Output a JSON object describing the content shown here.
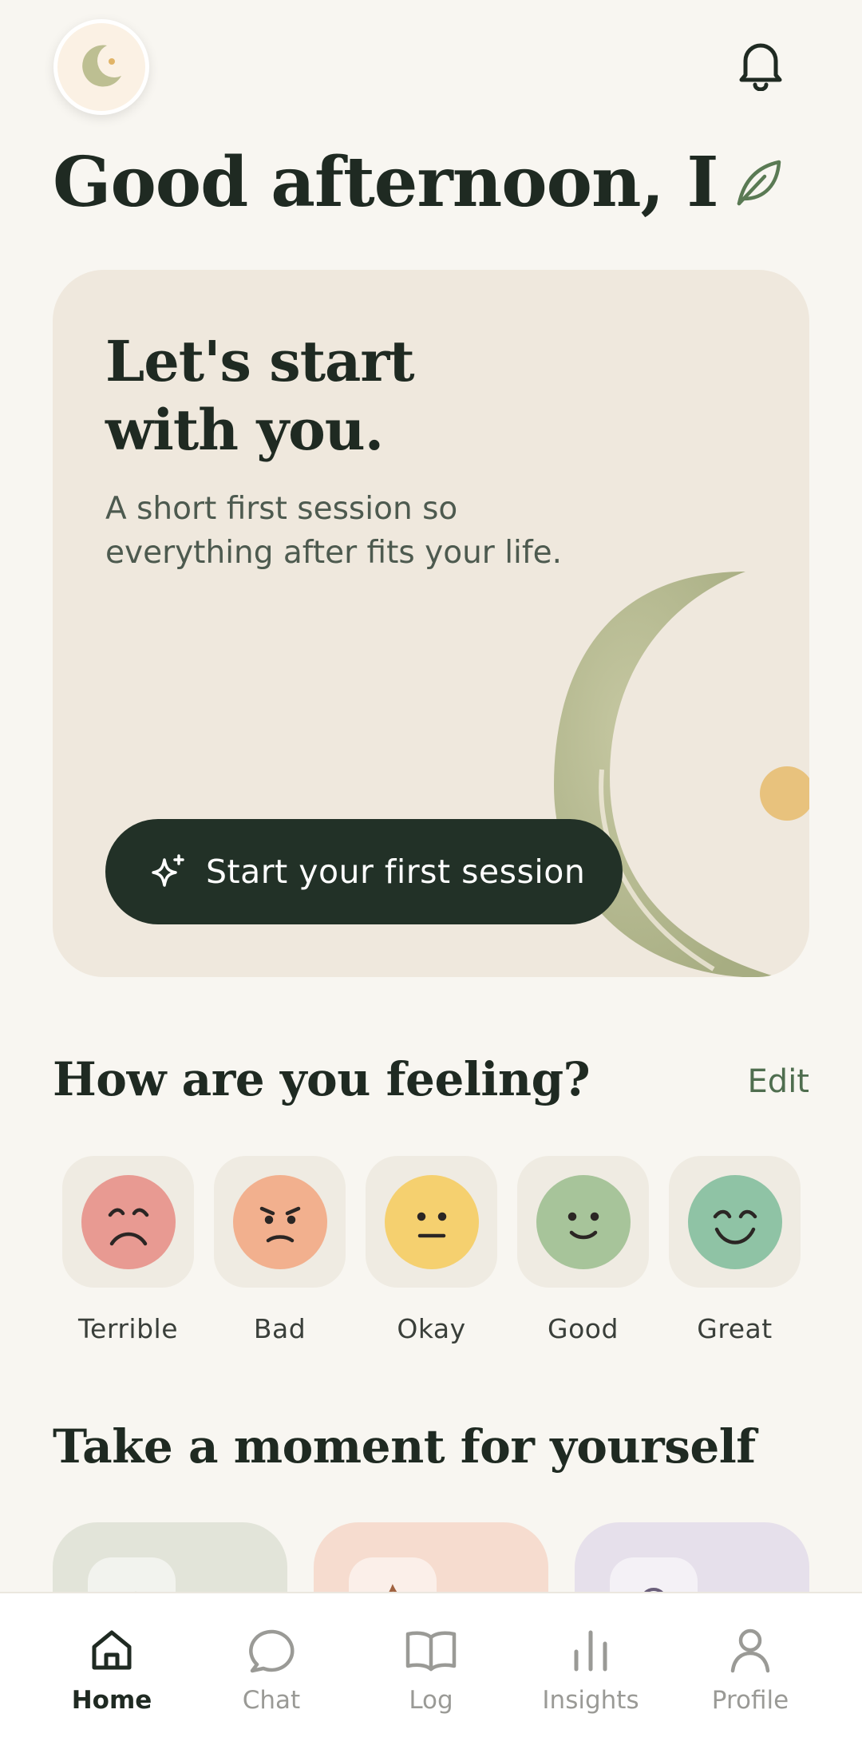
{
  "header": {
    "avatar_icon": "crescent-moon-icon",
    "notification_icon": "bell-icon"
  },
  "greeting": {
    "text": "Good afternoon, I",
    "icon": "leaf-icon"
  },
  "hero": {
    "title_line1": "Let's start",
    "title_line2": "with you.",
    "subtitle_line1": "A short first session so",
    "subtitle_line2": "everything after fits your life.",
    "cta_label": "Start your first session",
    "cta_icon": "sparkle-icon"
  },
  "mood_section": {
    "title": "How are you feeling?",
    "edit_label": "Edit",
    "moods": [
      {
        "label": "Terrible",
        "color": "#e89a92"
      },
      {
        "label": "Bad",
        "color": "#f2b08e"
      },
      {
        "label": "Okay",
        "color": "#f5d06f"
      },
      {
        "label": "Good",
        "color": "#a7c49a"
      },
      {
        "label": "Great",
        "color": "#8fc3a5"
      }
    ]
  },
  "moment_section": {
    "title": "Take a moment for yourself",
    "cards": [
      {
        "color": "#e2e4d9",
        "icon": "arrow-right-icon"
      },
      {
        "color": "#f6dccf",
        "icon": "flame-icon"
      },
      {
        "color": "#e6e0eb",
        "icon": "circle-icon"
      }
    ]
  },
  "tabbar": {
    "items": [
      {
        "label": "Home",
        "icon": "home-icon",
        "active": true
      },
      {
        "label": "Chat",
        "icon": "chat-bubble-icon",
        "active": false
      },
      {
        "label": "Log",
        "icon": "book-icon",
        "active": false
      },
      {
        "label": "Insights",
        "icon": "bar-chart-icon",
        "active": false
      },
      {
        "label": "Profile",
        "icon": "person-icon",
        "active": false
      }
    ]
  },
  "colors": {
    "background": "#f8f6f1",
    "hero_card": "#efe8dd",
    "cta": "#223127",
    "accent_green": "#4f6e4f"
  }
}
